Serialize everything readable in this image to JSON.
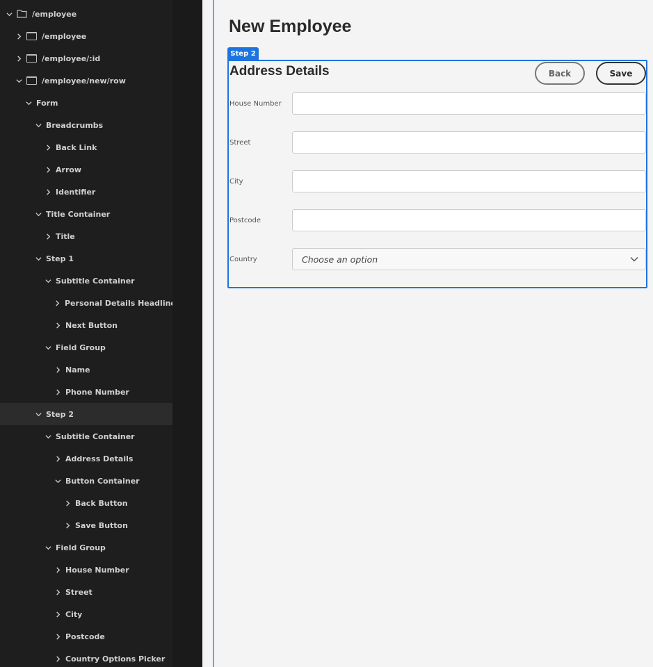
{
  "sidebar": {
    "tree": [
      {
        "label": "/employee",
        "level": 0,
        "expanded": true,
        "icon": "folder"
      },
      {
        "label": "/employee",
        "level": 1,
        "expanded": false,
        "icon": "window"
      },
      {
        "label": "/employee/:id",
        "level": 1,
        "expanded": false,
        "icon": "window"
      },
      {
        "label": "/employee/new/row",
        "level": 1,
        "expanded": true,
        "icon": "window"
      },
      {
        "label": "Form",
        "level": 2,
        "expanded": true
      },
      {
        "label": "Breadcrumbs",
        "level": 3,
        "expanded": true
      },
      {
        "label": "Back Link",
        "level": 4,
        "expanded": false
      },
      {
        "label": "Arrow",
        "level": 4,
        "expanded": false
      },
      {
        "label": "Identifier",
        "level": 4,
        "expanded": false
      },
      {
        "label": "Title Container",
        "level": 3,
        "expanded": true
      },
      {
        "label": "Title",
        "level": 4,
        "expanded": false
      },
      {
        "label": "Step 1",
        "level": 3,
        "expanded": true
      },
      {
        "label": "Subtitle Container",
        "level": 4,
        "expanded": true
      },
      {
        "label": "Personal Details Headline",
        "level": 5,
        "expanded": false
      },
      {
        "label": "Next Button",
        "level": 5,
        "expanded": false
      },
      {
        "label": "Field Group",
        "level": 4,
        "expanded": true
      },
      {
        "label": "Name",
        "level": 5,
        "expanded": false
      },
      {
        "label": "Phone Number",
        "level": 5,
        "expanded": false
      },
      {
        "label": "Step 2",
        "level": 3,
        "expanded": true,
        "selected": true
      },
      {
        "label": "Subtitle Container",
        "level": 4,
        "expanded": true
      },
      {
        "label": "Address Details",
        "level": 5,
        "expanded": false
      },
      {
        "label": "Button Container",
        "level": 5,
        "expanded": true
      },
      {
        "label": "Back Button",
        "level": 6,
        "expanded": false
      },
      {
        "label": "Save Button",
        "level": 6,
        "expanded": false
      },
      {
        "label": "Field Group",
        "level": 4,
        "expanded": true
      },
      {
        "label": "House Number",
        "level": 5,
        "expanded": false
      },
      {
        "label": "Street",
        "level": 5,
        "expanded": false
      },
      {
        "label": "City",
        "level": 5,
        "expanded": false
      },
      {
        "label": "Postcode",
        "level": 5,
        "expanded": false
      },
      {
        "label": "Country Options Picker",
        "level": 5,
        "expanded": false
      }
    ]
  },
  "main": {
    "title": "New Employee",
    "step_tag": "Step 2",
    "subtitle": "Address Details",
    "back_label": "Back",
    "save_label": "Save",
    "fields": [
      {
        "label": "House Number",
        "value": ""
      },
      {
        "label": "Street",
        "value": ""
      },
      {
        "label": "City",
        "value": ""
      },
      {
        "label": "Postcode",
        "value": ""
      }
    ],
    "country": {
      "label": "Country",
      "placeholder": "Choose an option"
    }
  },
  "colors": {
    "accent": "#1c74e0",
    "sidebar": "#1e1e1e",
    "selected_row": "#2c2c2c"
  }
}
